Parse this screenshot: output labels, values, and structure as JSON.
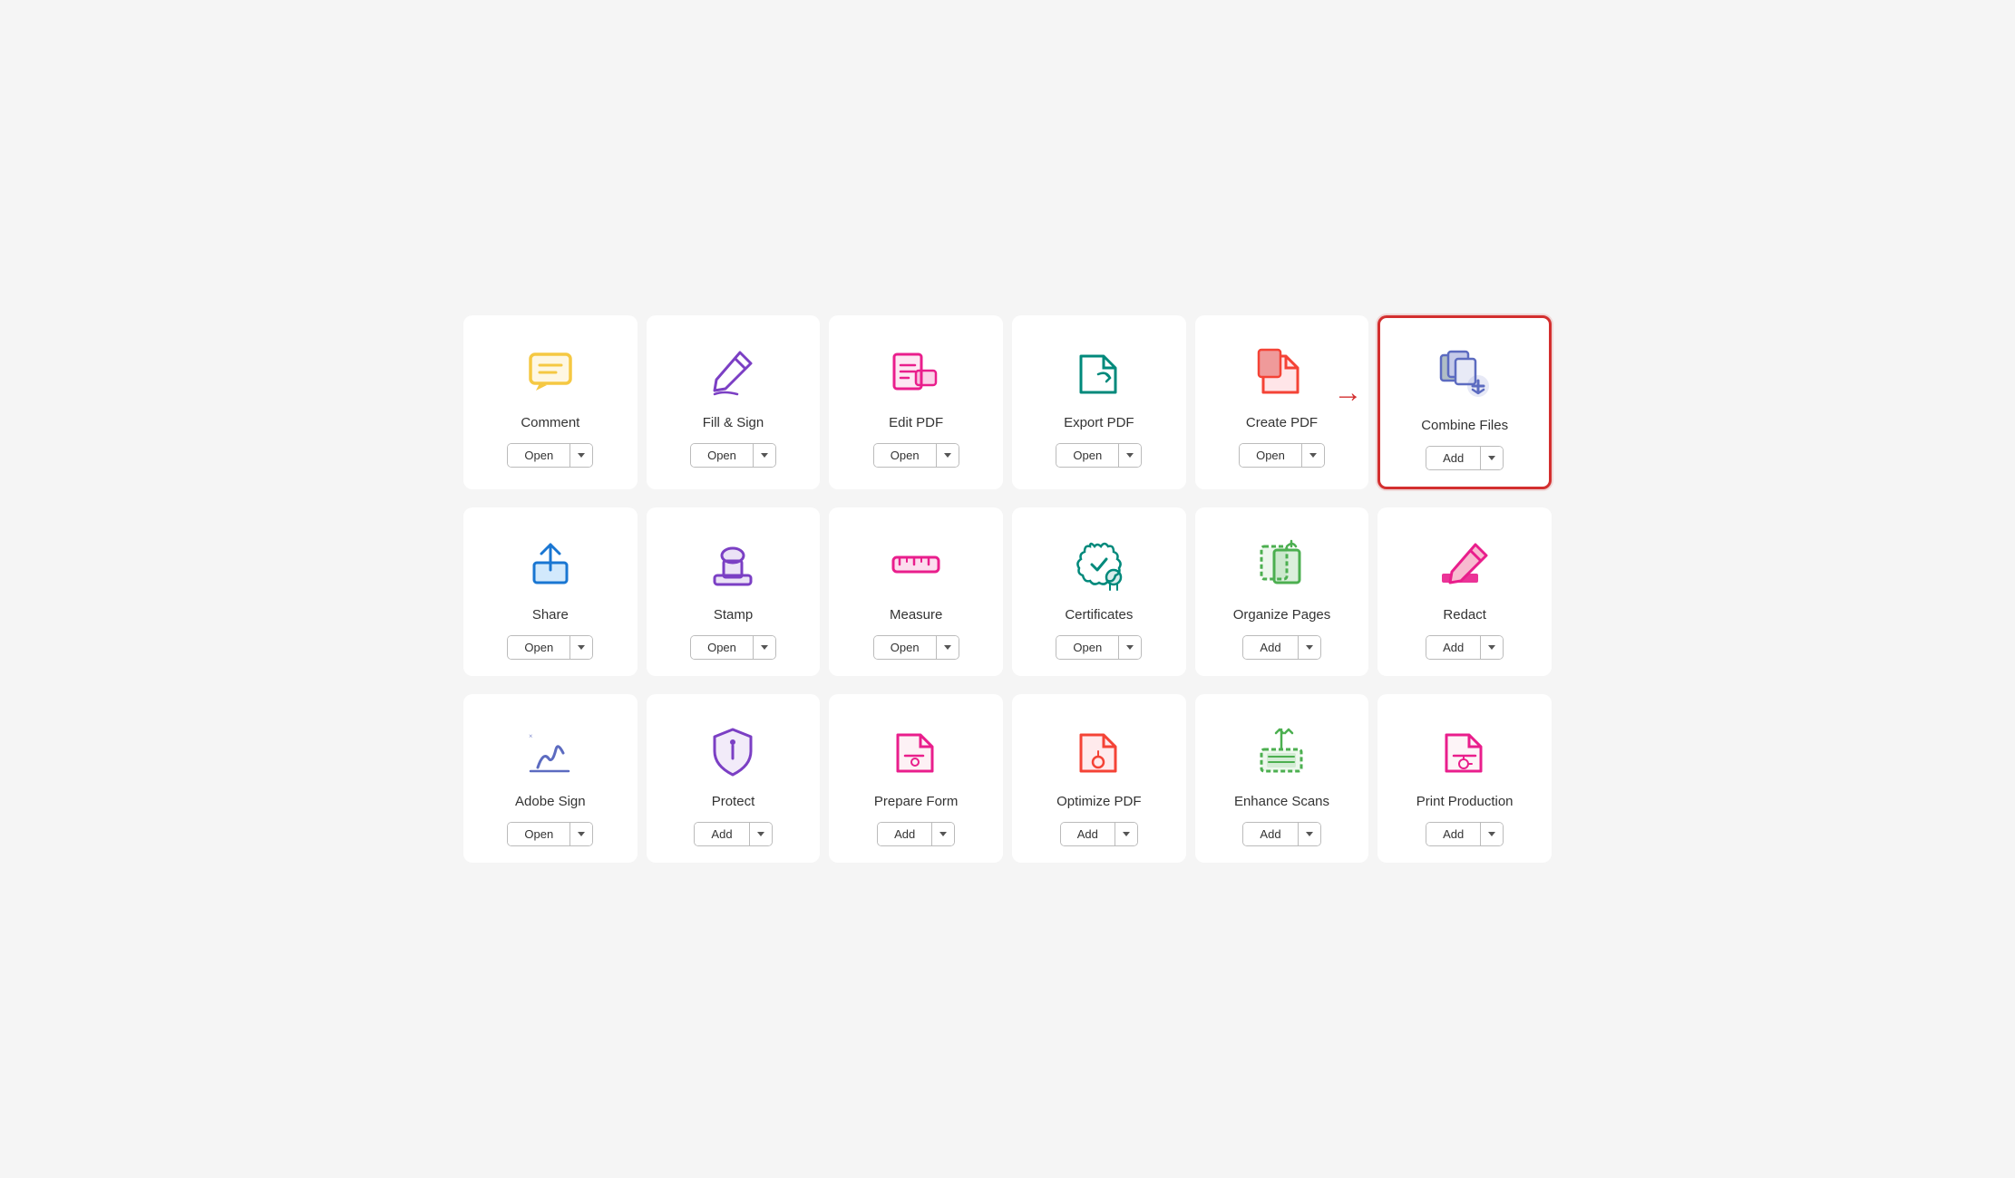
{
  "tools": [
    {
      "id": "comment",
      "label": "Comment",
      "btn": "Open",
      "highlighted": false,
      "iconType": "comment"
    },
    {
      "id": "fill-sign",
      "label": "Fill & Sign",
      "btn": "Open",
      "highlighted": false,
      "iconType": "fill-sign"
    },
    {
      "id": "edit-pdf",
      "label": "Edit PDF",
      "btn": "Open",
      "highlighted": false,
      "iconType": "edit-pdf"
    },
    {
      "id": "export-pdf",
      "label": "Export PDF",
      "btn": "Open",
      "highlighted": false,
      "iconType": "export-pdf"
    },
    {
      "id": "create-pdf",
      "label": "Create PDF",
      "btn": "Open",
      "highlighted": false,
      "iconType": "create-pdf"
    },
    {
      "id": "combine-files",
      "label": "Combine Files",
      "btn": "Add",
      "highlighted": true,
      "iconType": "combine-files"
    },
    {
      "id": "share",
      "label": "Share",
      "btn": "Open",
      "highlighted": false,
      "iconType": "share"
    },
    {
      "id": "stamp",
      "label": "Stamp",
      "btn": "Open",
      "highlighted": false,
      "iconType": "stamp"
    },
    {
      "id": "measure",
      "label": "Measure",
      "btn": "Open",
      "highlighted": false,
      "iconType": "measure"
    },
    {
      "id": "certificates",
      "label": "Certificates",
      "btn": "Open",
      "highlighted": false,
      "iconType": "certificates"
    },
    {
      "id": "organize-pages",
      "label": "Organize Pages",
      "btn": "Add",
      "highlighted": false,
      "iconType": "organize-pages"
    },
    {
      "id": "redact",
      "label": "Redact",
      "btn": "Add",
      "highlighted": false,
      "iconType": "redact"
    },
    {
      "id": "adobe-sign",
      "label": "Adobe Sign",
      "btn": "Open",
      "highlighted": false,
      "iconType": "adobe-sign"
    },
    {
      "id": "protect",
      "label": "Protect",
      "btn": "Add",
      "highlighted": false,
      "iconType": "protect"
    },
    {
      "id": "prepare-form",
      "label": "Prepare Form",
      "btn": "Add",
      "highlighted": false,
      "iconType": "prepare-form"
    },
    {
      "id": "optimize-pdf",
      "label": "Optimize PDF",
      "btn": "Add",
      "highlighted": false,
      "iconType": "optimize-pdf"
    },
    {
      "id": "enhance-scans",
      "label": "Enhance Scans",
      "btn": "Add",
      "highlighted": false,
      "iconType": "enhance-scans"
    },
    {
      "id": "print-production",
      "label": "Print Production",
      "btn": "Add",
      "highlighted": false,
      "iconType": "print-production"
    }
  ]
}
